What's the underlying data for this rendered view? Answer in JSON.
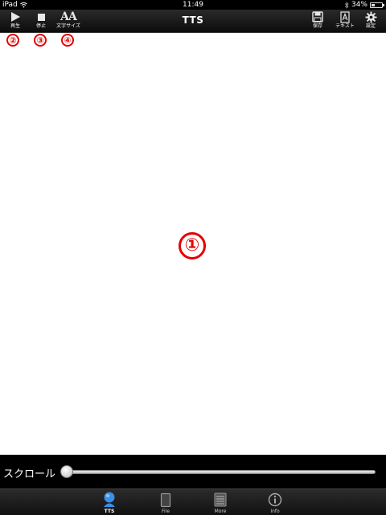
{
  "status_bar": {
    "device": "iPad",
    "time": "11:49",
    "battery": "34%",
    "battery_level": 0.34
  },
  "toolbar": {
    "title": "TTS",
    "play_label": "再生",
    "stop_label": "停止",
    "font_size_label": "文字サイズ",
    "font_size_glyph": "AA",
    "save_label": "保存",
    "text_label": "テキスト",
    "settings_label": "設定"
  },
  "annotations": {
    "content": "①",
    "play": "②",
    "stop": "③",
    "font_size": "④"
  },
  "scroll": {
    "label": "スクロール",
    "value": 0
  },
  "tabs": [
    {
      "label": "TTS",
      "icon": "tts-icon",
      "active": true
    },
    {
      "label": "File",
      "icon": "file-icon",
      "active": false
    },
    {
      "label": "More",
      "icon": "more-icon",
      "active": false
    },
    {
      "label": "Info",
      "icon": "info-icon",
      "active": false
    }
  ],
  "colors": {
    "annotation": "#e60000",
    "active_tab": "#3a8ee6"
  }
}
